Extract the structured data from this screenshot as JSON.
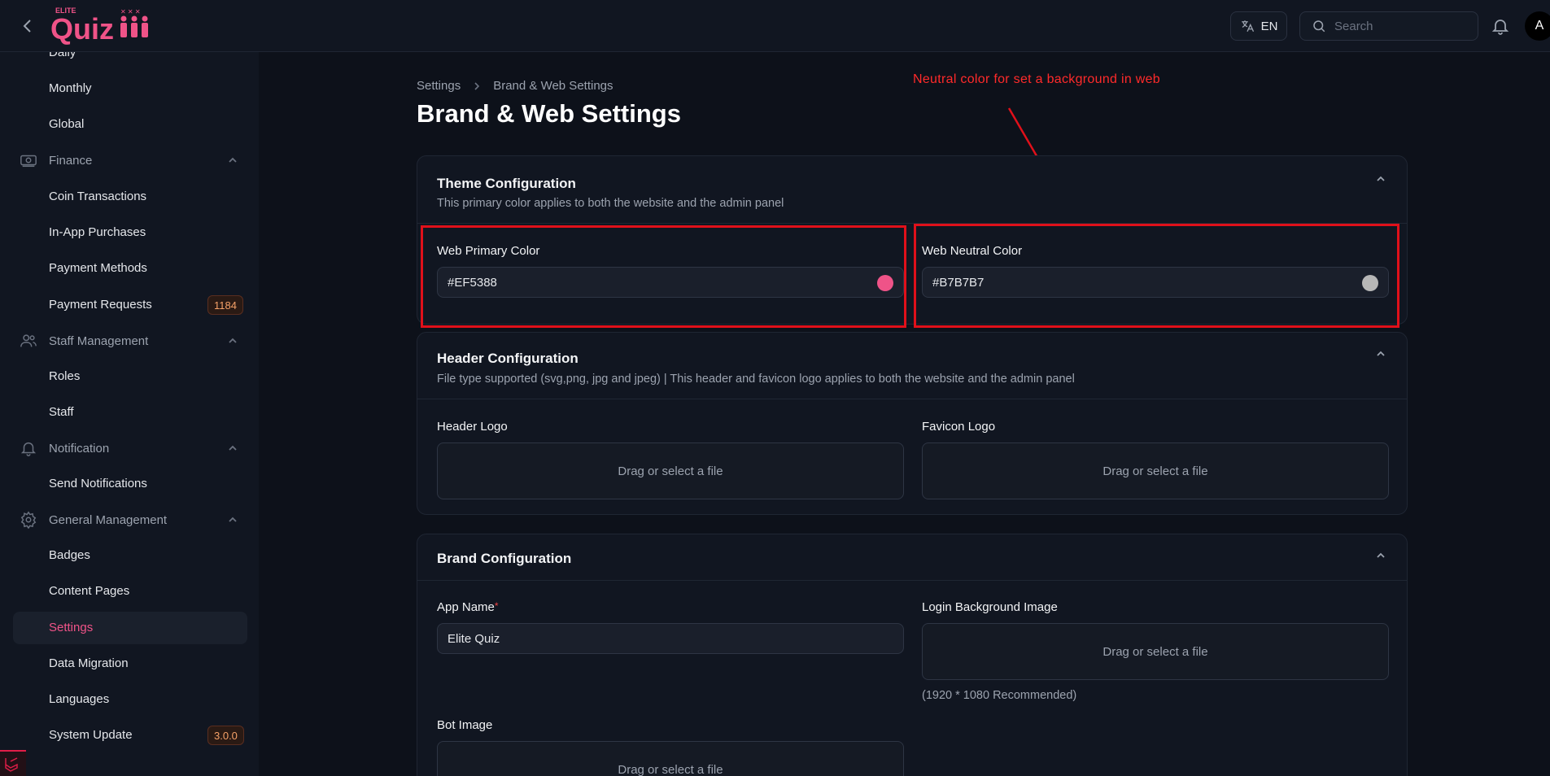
{
  "topbar": {
    "logo_small": "ELITE",
    "logo_text": "Quiz",
    "lang_label": "EN",
    "search_placeholder": "Search",
    "avatar_letter": "A"
  },
  "sidebar": {
    "items": {
      "daily": "Daily",
      "monthly": "Monthly",
      "global": "Global",
      "finance": "Finance",
      "coin_transactions": "Coin Transactions",
      "in_app_purchases": "In-App Purchases",
      "payment_methods": "Payment Methods",
      "payment_requests": "Payment Requests",
      "payment_requests_badge": "1184",
      "staff_management": "Staff Management",
      "roles": "Roles",
      "staff": "Staff",
      "notification": "Notification",
      "send_notifications": "Send Notifications",
      "general_management": "General Management",
      "badges": "Badges",
      "content_pages": "Content Pages",
      "settings": "Settings",
      "data_migration": "Data Migration",
      "languages": "Languages",
      "system_update": "System Update",
      "system_update_badge": "3.0.0"
    },
    "active_color": "#f05388"
  },
  "breadcrumb": {
    "root": "Settings",
    "current": "Brand & Web Settings"
  },
  "page_title": "Brand & Web Settings",
  "annotation": "Neutral color for set a background in web",
  "theme": {
    "title": "Theme Configuration",
    "description": "This primary color applies to both the website and the admin panel",
    "primary_label": "Web Primary Color",
    "primary_value": "#EF5388",
    "neutral_label": "Web Neutral Color",
    "neutral_value": "#B7B7B7"
  },
  "header_config": {
    "title": "Header Configuration",
    "description": "File type supported (svg,png, jpg and jpeg) | This header and favicon logo applies to both the website and the admin panel",
    "header_logo_label": "Header Logo",
    "favicon_logo_label": "Favicon Logo",
    "dropzone_text": "Drag or select a file"
  },
  "brand_config": {
    "title": "Brand Configuration",
    "app_name_label": "App Name",
    "required_mark": "*",
    "app_name_value": "Elite Quiz",
    "login_bg_label": "Login Background Image",
    "login_bg_hint": "(1920 * 1080 Recommended)",
    "bot_image_label": "Bot Image",
    "dropzone_text": "Drag or select a file"
  },
  "colors": {
    "accent": "#EF5388",
    "annotation_red": "#e0101a",
    "background": "#0d111a"
  }
}
